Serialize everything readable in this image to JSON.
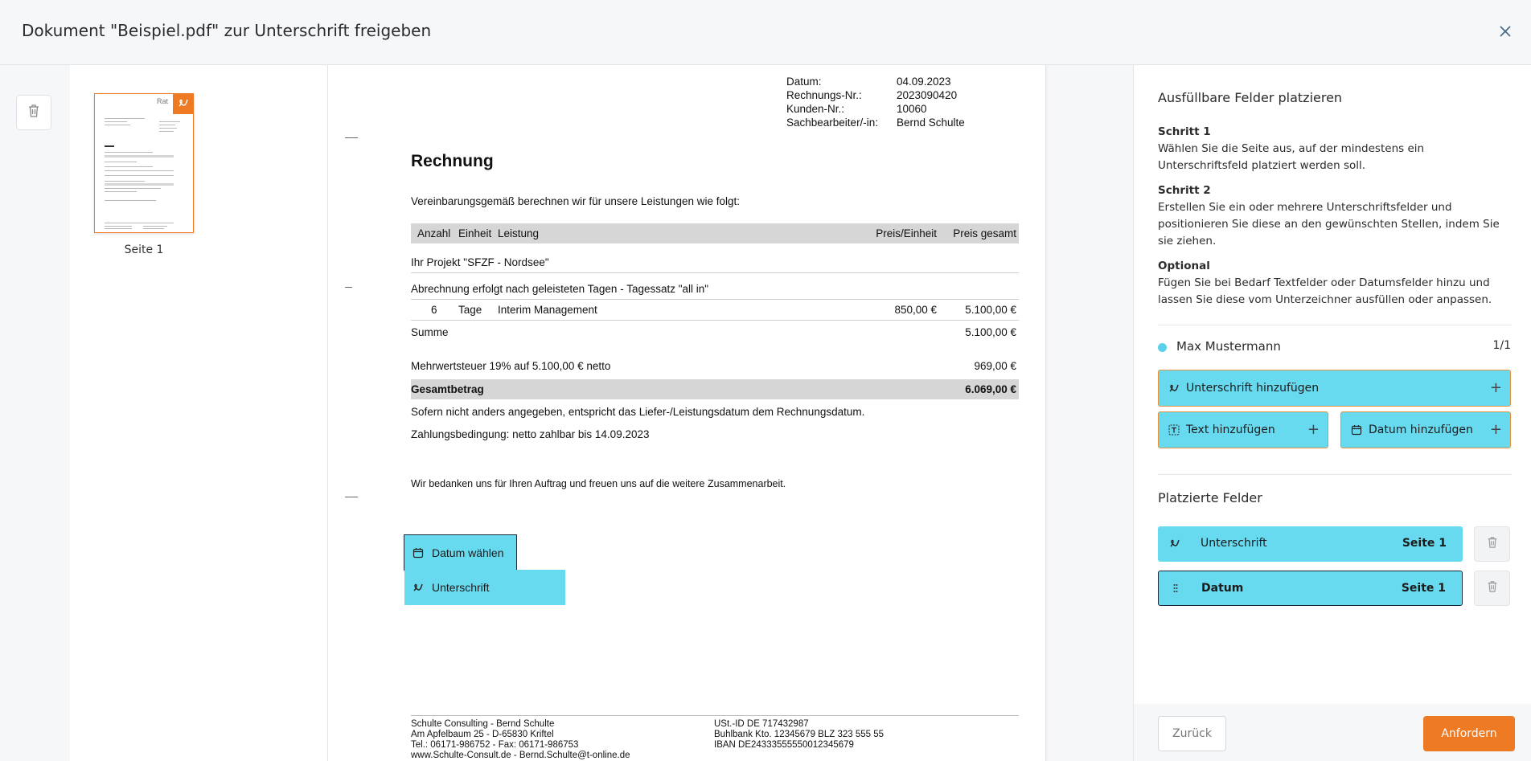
{
  "dialog": {
    "title": "Dokument \"Beispiel.pdf\" zur Unterschrift freigeben"
  },
  "thumbnails": [
    {
      "label": "Seite 1",
      "thumb_logo_text": "Rat"
    }
  ],
  "document": {
    "meta": [
      {
        "label": "Datum:",
        "value": "04.09.2023"
      },
      {
        "label": "Rechnungs-Nr.:",
        "value": "2023090420"
      },
      {
        "label": "Kunden-Nr.:",
        "value": "10060"
      },
      {
        "label": "Sachbearbeiter/-in:",
        "value": "Bernd Schulte"
      }
    ],
    "title": "Rechnung",
    "intro": "Vereinbarungsgemäß berechnen wir für unsere Leistungen wie folgt:",
    "table_headers": {
      "qty": "Anzahl",
      "unit": "Einheit",
      "service": "Leistung",
      "unit_price": "Preis/Einheit",
      "total": "Preis gesamt"
    },
    "project_line": "Ihr Projekt \"SFZF - Nordsee\"",
    "billing_note": "Abrechnung erfolgt nach geleisteten Tagen - Tagessatz \"all in\"",
    "item": {
      "qty": "6",
      "unit": "Tage",
      "service": "Interim Management",
      "unit_price": "850,00 €",
      "total": "5.100,00 €"
    },
    "sum_label": "Summe",
    "sum_value": "5.100,00 €",
    "vat_label": "Mehrwertsteuer 19% auf 5.100,00 € netto",
    "vat_value": "969,00 €",
    "grand_label": "Gesamtbetrag",
    "grand_value": "6.069,00 €",
    "delivery_note": "Sofern nicht anders angegeben, entspricht das Liefer-/Leistungsdatum dem Rechnungsdatum.",
    "payment_terms": "Zahlungsbedingung: netto zahlbar bis 14.09.2023",
    "thanks": "Wir bedanken uns für Ihren Auftrag und freuen uns auf die weitere Zusammenarbeit.",
    "footer_left": [
      "Schulte Consulting - Bernd Schulte",
      "Am Apfelbaum 25 - D-65830 Kriftel",
      "Tel.: 06171-986752 - Fax: 06171-986753",
      "www.Schulte-Consult.de - Bernd.Schulte@t-online.de"
    ],
    "footer_right": [
      "USt.-ID DE 717432987",
      "Buhlbank Kto. 12345679 BLZ 323 555 55",
      "IBAN DE24333555550012345679"
    ],
    "placed_date_label": "Datum wählen",
    "placed_signature_label": "Unterschrift"
  },
  "panel": {
    "heading": "Ausfüllbare Felder platzieren",
    "steps": [
      {
        "title": "Schritt 1",
        "text": "Wählen Sie die Seite aus, auf der mindestens ein Unterschriftsfeld platziert werden soll."
      },
      {
        "title": "Schritt 2",
        "text": "Erstellen Sie ein oder mehrere Unterschriftsfelder und positionieren Sie diese an den gewünschten Stellen, indem Sie sie ziehen."
      },
      {
        "title": "Optional",
        "text": "Fügen Sie bei Bedarf Textfelder oder Datumsfelder hinzu und lassen Sie diese vom Unterzeichner ausfüllen oder anpassen."
      }
    ],
    "signer": {
      "name": "Max Mustermann",
      "count": "1/1",
      "color": "#5bd0ea"
    },
    "add_signature_label": "Unterschrift hinzufügen",
    "add_text_label": "Text hinzufügen",
    "add_date_label": "Datum hinzufügen",
    "placed_heading": "Platzierte Felder",
    "placed_fields": [
      {
        "label": "Unterschrift",
        "page": "Seite 1",
        "icon": "signature-icon"
      },
      {
        "label": "Datum",
        "page": "Seite 1",
        "icon": "drag-handle-icon"
      }
    ]
  },
  "footer": {
    "back_label": "Zurück",
    "request_label": "Anfordern"
  },
  "colors": {
    "accent": "#ee7a24",
    "field": "#67daf0",
    "background": "#f6f7f9"
  }
}
